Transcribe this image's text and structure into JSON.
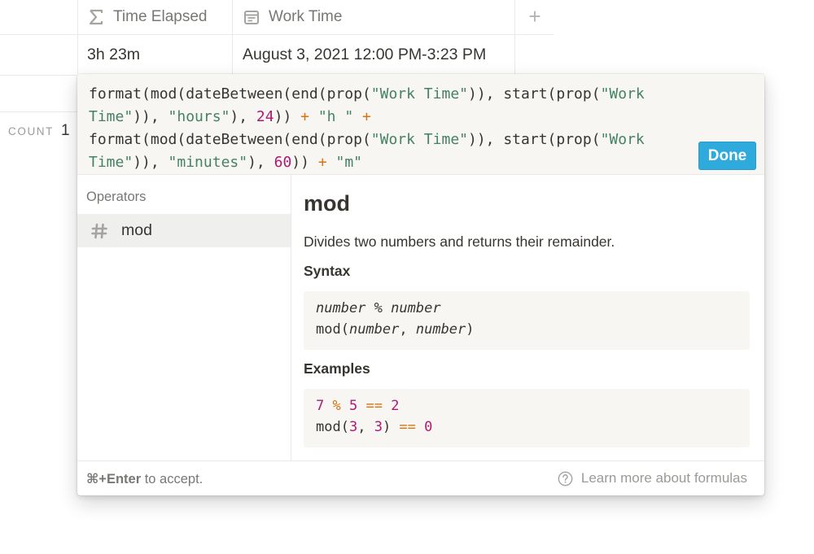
{
  "table": {
    "columns": [
      {
        "icon": "sigma-icon",
        "label": "Time Elapsed"
      },
      {
        "icon": "calendar-icon",
        "label": "Work Time"
      }
    ],
    "add_column_label": "+",
    "row": {
      "time_elapsed": "3h 23m",
      "work_time": "August 3, 2021 12:00 PM-3:23 PM"
    },
    "count_label": "COUNT",
    "count_value": "1"
  },
  "formula_popup": {
    "editor": {
      "lines": [
        [
          {
            "t": "format(mod(dateBetween(end(prop(",
            "c": "p"
          },
          {
            "t": "\"Work Time\"",
            "c": "s"
          },
          {
            "t": ")), start(prop(",
            "c": "p"
          },
          {
            "t": "\"Work",
            "c": "s"
          }
        ],
        [
          {
            "t": "Time\"",
            "c": "s"
          },
          {
            "t": ")), ",
            "c": "p"
          },
          {
            "t": "\"hours\"",
            "c": "s"
          },
          {
            "t": "), ",
            "c": "p"
          },
          {
            "t": "24",
            "c": "n"
          },
          {
            "t": ")) ",
            "c": "p"
          },
          {
            "t": "+",
            "c": "o"
          },
          {
            "t": " ",
            "c": "p"
          },
          {
            "t": "\"h \"",
            "c": "s"
          },
          {
            "t": " ",
            "c": "p"
          },
          {
            "t": "+",
            "c": "o"
          }
        ],
        [
          {
            "t": "format(mod(dateBetween(end(prop(",
            "c": "p"
          },
          {
            "t": "\"Work Time\"",
            "c": "s"
          },
          {
            "t": ")), start(prop(",
            "c": "p"
          },
          {
            "t": "\"Work",
            "c": "s"
          }
        ],
        [
          {
            "t": "Time\"",
            "c": "s"
          },
          {
            "t": ")), ",
            "c": "p"
          },
          {
            "t": "\"minutes\"",
            "c": "s"
          },
          {
            "t": "), ",
            "c": "p"
          },
          {
            "t": "60",
            "c": "n"
          },
          {
            "t": ")) ",
            "c": "p"
          },
          {
            "t": "+",
            "c": "o"
          },
          {
            "t": " ",
            "c": "p"
          },
          {
            "t": "\"m\"",
            "c": "s"
          }
        ]
      ],
      "done_label": "Done"
    },
    "sidebar": {
      "heading": "Operators",
      "items": [
        {
          "icon": "hash-icon",
          "label": "mod",
          "selected": true
        }
      ]
    },
    "doc": {
      "title": "mod",
      "description": "Divides two numbers and returns their remainder.",
      "syntax_heading": "Syntax",
      "syntax_lines": [
        [
          {
            "t": "number",
            "c": "i"
          },
          {
            "t": " % ",
            "c": "p"
          },
          {
            "t": "number",
            "c": "i"
          }
        ],
        [
          {
            "t": "mod(",
            "c": "p"
          },
          {
            "t": "number",
            "c": "i"
          },
          {
            "t": ", ",
            "c": "p"
          },
          {
            "t": "number",
            "c": "i"
          },
          {
            "t": ")",
            "c": "p"
          }
        ]
      ],
      "examples_heading": "Examples",
      "example_lines": [
        [
          {
            "t": "7",
            "c": "n"
          },
          {
            "t": " ",
            "c": "p"
          },
          {
            "t": "%",
            "c": "o"
          },
          {
            "t": " ",
            "c": "p"
          },
          {
            "t": "5",
            "c": "n"
          },
          {
            "t": " ",
            "c": "p"
          },
          {
            "t": "==",
            "c": "o"
          },
          {
            "t": " ",
            "c": "p"
          },
          {
            "t": "2",
            "c": "n"
          }
        ],
        [
          {
            "t": "mod(",
            "c": "p"
          },
          {
            "t": "3",
            "c": "n"
          },
          {
            "t": ", ",
            "c": "p"
          },
          {
            "t": "3",
            "c": "n"
          },
          {
            "t": ") ",
            "c": "p"
          },
          {
            "t": "==",
            "c": "o"
          },
          {
            "t": " ",
            "c": "p"
          },
          {
            "t": "0",
            "c": "n"
          }
        ]
      ]
    },
    "footer": {
      "shortcut": "⌘+Enter",
      "shortcut_suffix": " to accept.",
      "help_icon": "question-circle-icon",
      "help_link": "Learn more about formulas"
    }
  },
  "colors": {
    "accent_button": "#2eaadc",
    "string_token": "#448361",
    "number_token": "#ad1a72",
    "operator_token": "#d9730d",
    "text_primary": "#37352f",
    "text_secondary": "#787774"
  }
}
